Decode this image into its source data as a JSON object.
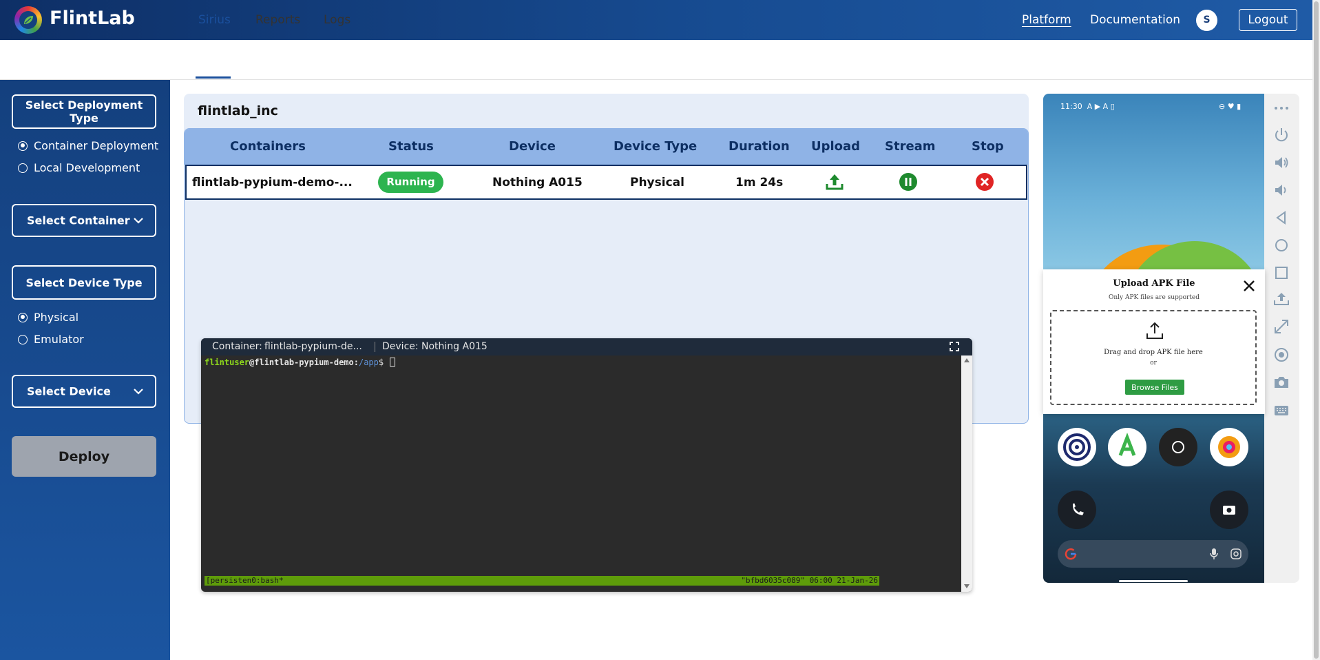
{
  "header": {
    "brand": "FlintLab",
    "nav": [
      "Platform",
      "Documentation"
    ],
    "avatar_initial": "S",
    "logout_label": "Logout"
  },
  "tabs": [
    "Sirius",
    "Reports",
    "Logs"
  ],
  "sidebar": {
    "deployment_type_label": "Select Deployment Type",
    "deployment_options": [
      "Container Deployment",
      "Local Development"
    ],
    "container_label": "Select Container",
    "device_type_label": "Select Device Type",
    "device_type_options": [
      "Physical",
      "Emulator"
    ],
    "device_label": "Select Device",
    "deploy_label": "Deploy"
  },
  "card": {
    "title": "flintlab_inc",
    "columns": [
      "Containers",
      "Status",
      "Device",
      "Device Type",
      "Duration",
      "Upload",
      "Stream",
      "Stop"
    ],
    "row": {
      "container": "flintlab-pypium-demo-...",
      "status": "Running",
      "device": "Nothing A015",
      "device_type": "Physical",
      "duration": "1m 24s"
    }
  },
  "terminal": {
    "container_label": "Container:",
    "container_value": "flintlab-pypium-de...",
    "device_label": "Device:",
    "device_value": "Nothing A015",
    "prompt_user": "flintuser",
    "prompt_host": "@flintlab-pypium-demo:",
    "prompt_path": "/app",
    "prompt_end": "$ ",
    "status_left": "[persisten0:bash*",
    "status_right": "\"bfbd6035c089\" 06:00 21-Jan-26"
  },
  "phone": {
    "time": "11:30",
    "status_left_icons": "A ▶ A ▯",
    "status_right_icons": "⊖ ♥ ▮"
  },
  "upload_modal": {
    "title": "Upload APK File",
    "subtitle": "Only APK files are supported",
    "drop_text": "Drag and drop APK file here",
    "or_text": "or",
    "browse_label": "Browse Files"
  },
  "colors": {
    "header_dark": "#0e2f66",
    "accent": "#1a4f9c",
    "running": "#2db44f",
    "stop": "#e02424",
    "table_header": "#8fb3e6"
  }
}
